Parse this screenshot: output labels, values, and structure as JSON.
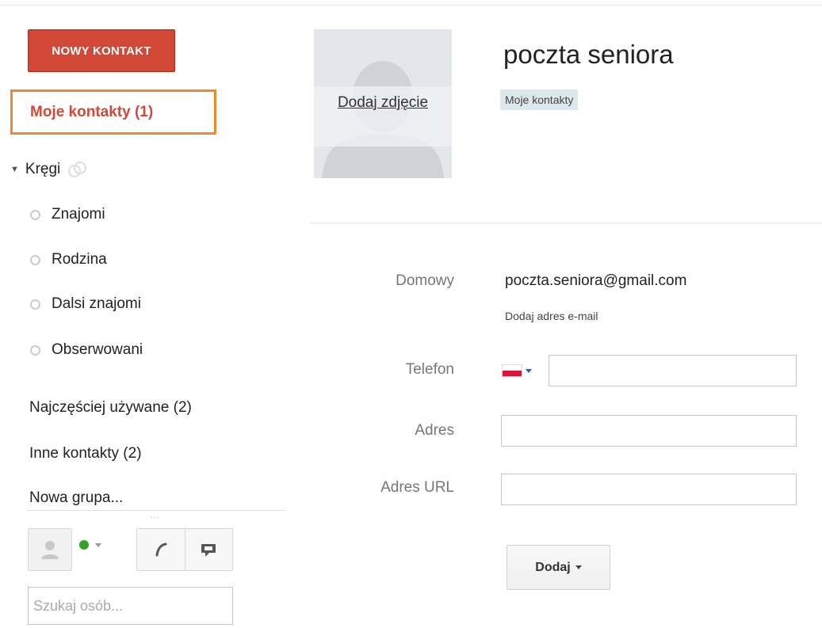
{
  "sidebar": {
    "new_contact_label": "NOWY KONTAKT",
    "my_contacts_label": "Moje kontakty (1)",
    "circles_label": "Kręgi",
    "circles": [
      {
        "label": "Znajomi"
      },
      {
        "label": "Rodzina"
      },
      {
        "label": "Dalsi znajomi"
      },
      {
        "label": "Obserwowani"
      }
    ],
    "most_used_label": "Najczęściej używane (2)",
    "other_contacts_label": "Inne kontakty (2)",
    "new_group_label": "Nowa grupa...",
    "dots": "...",
    "status_color": "#34a12a",
    "search_placeholder": "Szukaj osób..."
  },
  "contact": {
    "add_photo_label": "Dodaj zdjęcie",
    "name": "poczta seniora",
    "group_chip": "Moje kontakty",
    "email_label": "Domowy",
    "email_value": "poczta.seniora@gmail.com",
    "add_email_label": "Dodaj adres e-mail",
    "phone_label": "Telefon",
    "phone_value": "",
    "address_label": "Adres",
    "address_value": "",
    "url_label": "Adres URL",
    "url_value": "",
    "add_button_label": "Dodaj"
  },
  "colors": {
    "accent_red": "#d14836",
    "highlight_orange": "#ee8a2c"
  }
}
